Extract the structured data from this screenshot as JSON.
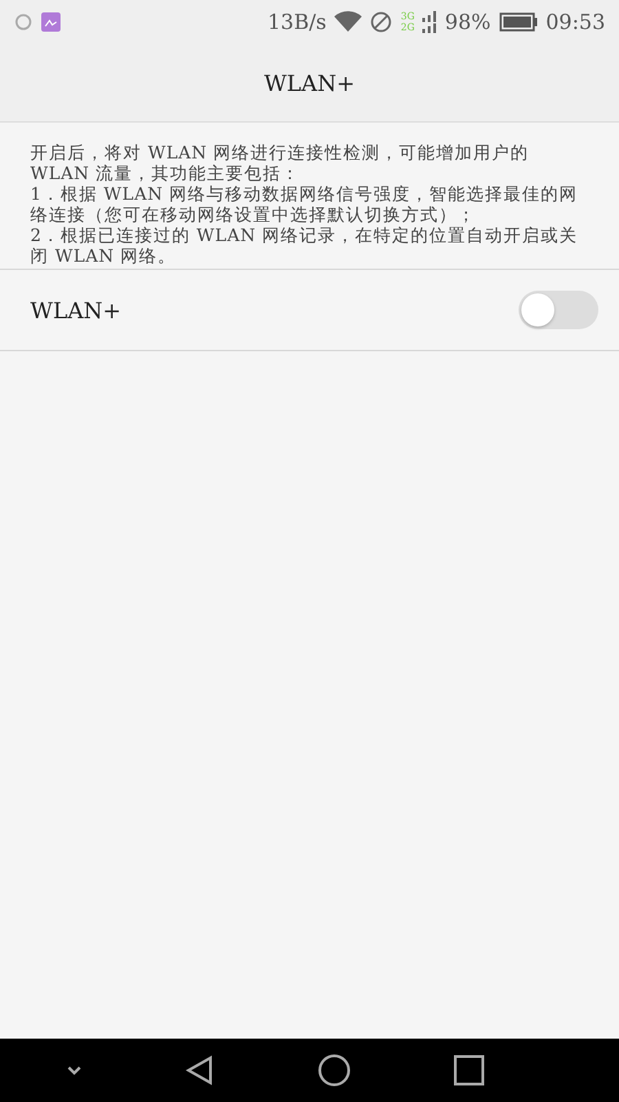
{
  "status_bar": {
    "speed": "13B/s",
    "network_top": "3G",
    "network_bottom": "2G",
    "battery": "98%",
    "time": "09:53"
  },
  "title": "WLAN+",
  "description": [
    "开启后，将对 WLAN 网络进行连接性检测，可能增加用户的 WLAN 流量，其功能主要包括：",
    "1．根据 WLAN 网络与移动数据网络信号强度，智能选择最佳的网络连接（您可在移动网络设置中选择默认切换方式）；",
    "2．根据已连接过的 WLAN 网络记录，在特定的位置自动开启或关闭 WLAN 网络。"
  ],
  "setting": {
    "label": "WLAN+",
    "on": false
  }
}
